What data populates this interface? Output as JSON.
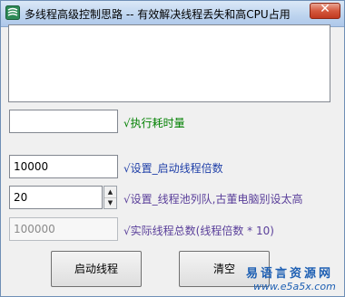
{
  "window": {
    "title": "多线程高级控制思路 -- 有效解决线程丢失和高CPU占用",
    "close_label": "✕"
  },
  "log_area": {
    "value": ""
  },
  "rows": {
    "elapsed": {
      "value": "",
      "label": "√执行耗时量"
    },
    "multiplier": {
      "value": "10000",
      "label": "√设置_启动线程倍数"
    },
    "pool": {
      "value": "20",
      "label": "√设置_线程池列队,古董电脑别设太高"
    },
    "total": {
      "value": "100000",
      "label": "√实际线程总数(线程倍数 * 10)"
    }
  },
  "buttons": {
    "start_label": "启动线程",
    "clear_label": "清空"
  },
  "watermark": {
    "cn": "易语言资源网",
    "url": "www.e5a5x.com"
  },
  "colors": {
    "label_blue": "#1f3fa8",
    "label_green": "#008000",
    "label_purple": "#5a3f9a"
  }
}
